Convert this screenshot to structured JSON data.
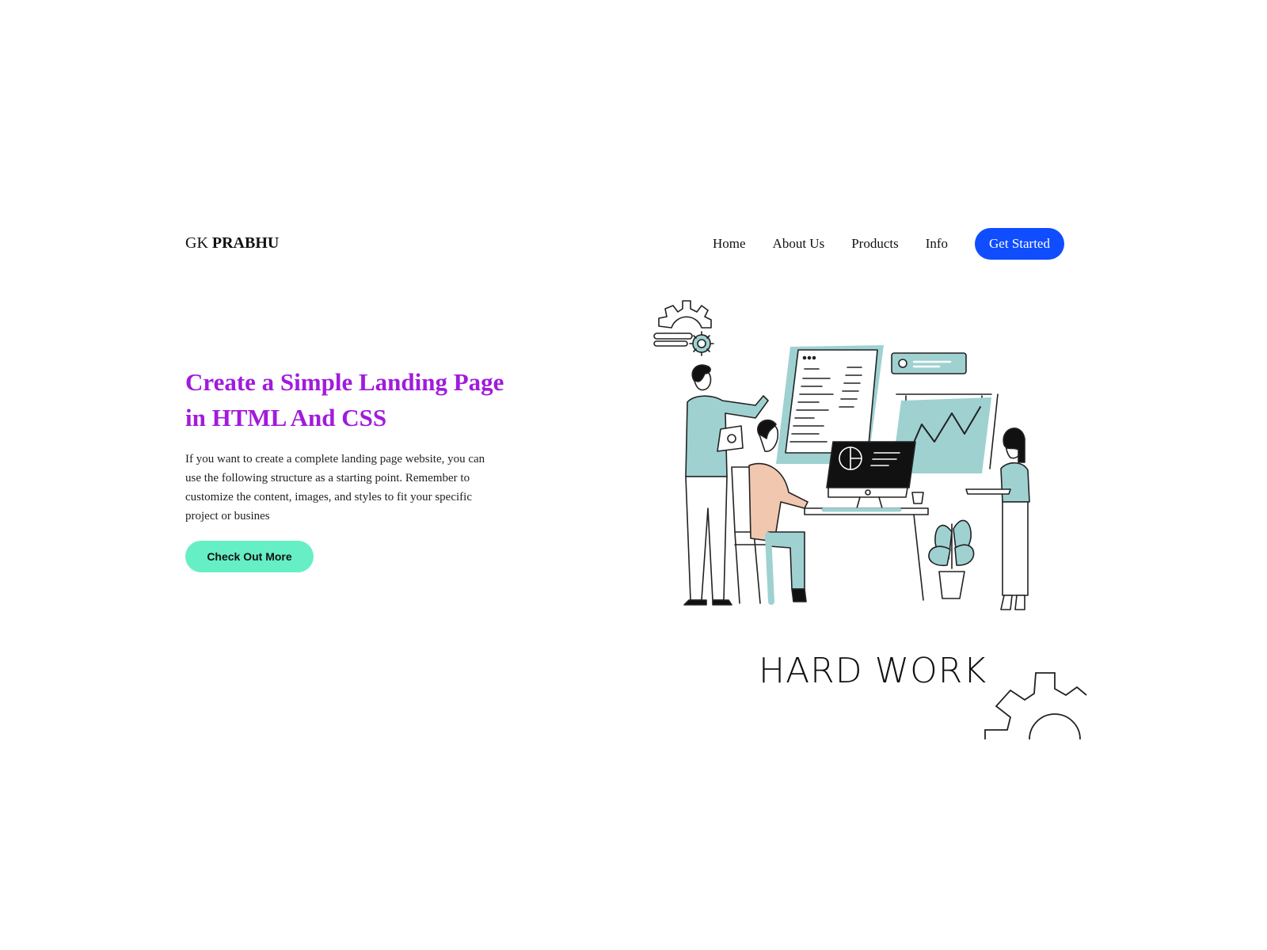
{
  "brand": {
    "name_regular": "GK ",
    "name_bold": "PRABHU"
  },
  "nav": {
    "items": [
      {
        "label": "Home"
      },
      {
        "label": "About Us"
      },
      {
        "label": "Products"
      },
      {
        "label": "Info"
      }
    ],
    "cta_label": "Get Started"
  },
  "hero": {
    "title": "Create a Simple Landing Page in HTML And CSS",
    "description": "If you want to create a complete landing page website, you can use the following structure as a starting point. Remember to customize the content, images, and styles to fit your specific project or busines",
    "button_label": "Check Out More"
  },
  "illustration": {
    "caption": "HARD WORK",
    "icons": [
      "gear-icon",
      "team-illustration",
      "gear-outline-icon"
    ]
  },
  "colors": {
    "accent": "#0f4dff",
    "title": "#a11bdc",
    "button_secondary": "#66efc4",
    "illustration_fill": "#9fd1d1"
  }
}
